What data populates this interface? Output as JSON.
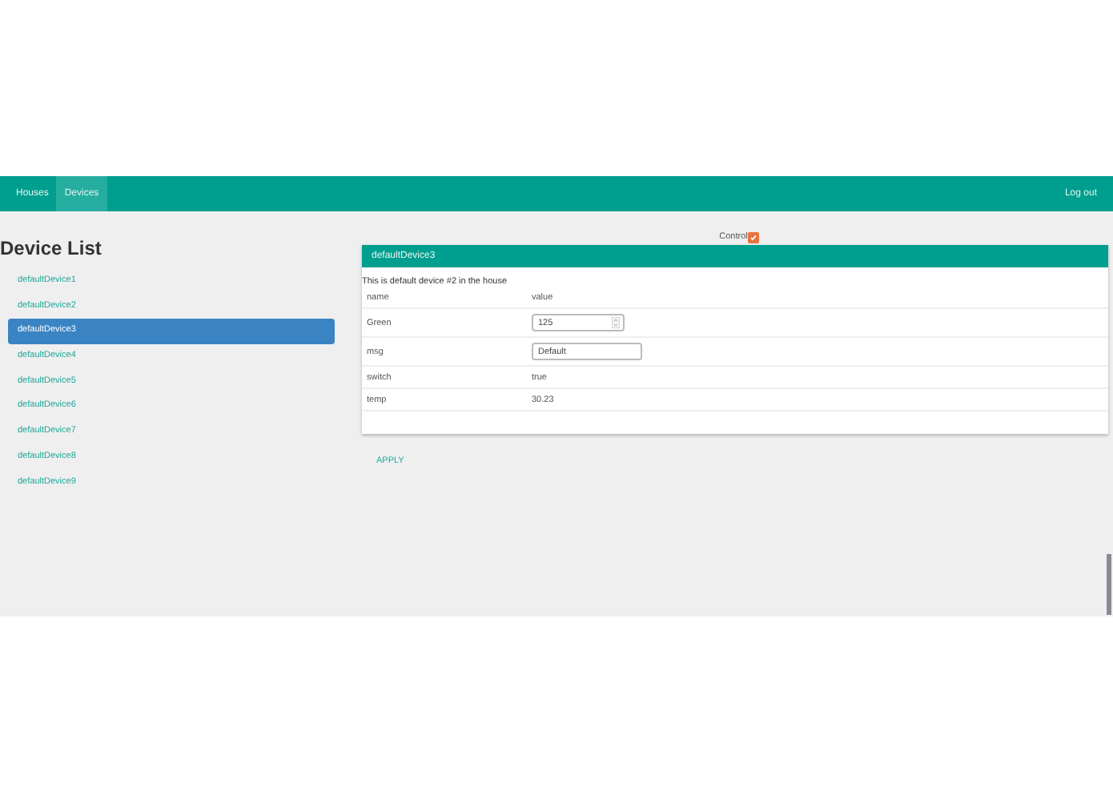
{
  "navbar": {
    "items": [
      {
        "label": "Houses",
        "selected": false
      },
      {
        "label": "Devices",
        "selected": true
      }
    ],
    "logout": "Log out"
  },
  "device_list": {
    "title": "Device List",
    "items": [
      {
        "label": "defaultDevice1",
        "selected": false
      },
      {
        "label": "defaultDevice2",
        "selected": false
      },
      {
        "label": "defaultDevice3",
        "selected": true
      },
      {
        "label": "defaultDevice4",
        "selected": false
      },
      {
        "label": "defaultDevice5",
        "selected": false
      },
      {
        "label": "defaultDevice6",
        "selected": false
      },
      {
        "label": "defaultDevice7",
        "selected": false
      },
      {
        "label": "defaultDevice8",
        "selected": false
      },
      {
        "label": "defaultDevice9",
        "selected": false
      }
    ]
  },
  "control": {
    "label": "Control",
    "checked": true
  },
  "panel": {
    "title": "defaultDevice3",
    "description": "This is default device #2 in the house",
    "columns": [
      "name",
      "value"
    ],
    "rows": [
      {
        "name": "Green",
        "kind": "number",
        "value": "125"
      },
      {
        "name": "msg",
        "kind": "input",
        "value": "Default"
      },
      {
        "name": "switch",
        "kind": "text",
        "value": "true"
      },
      {
        "name": "temp",
        "kind": "text",
        "value": "30.23"
      }
    ]
  },
  "apply": "APPLY"
}
